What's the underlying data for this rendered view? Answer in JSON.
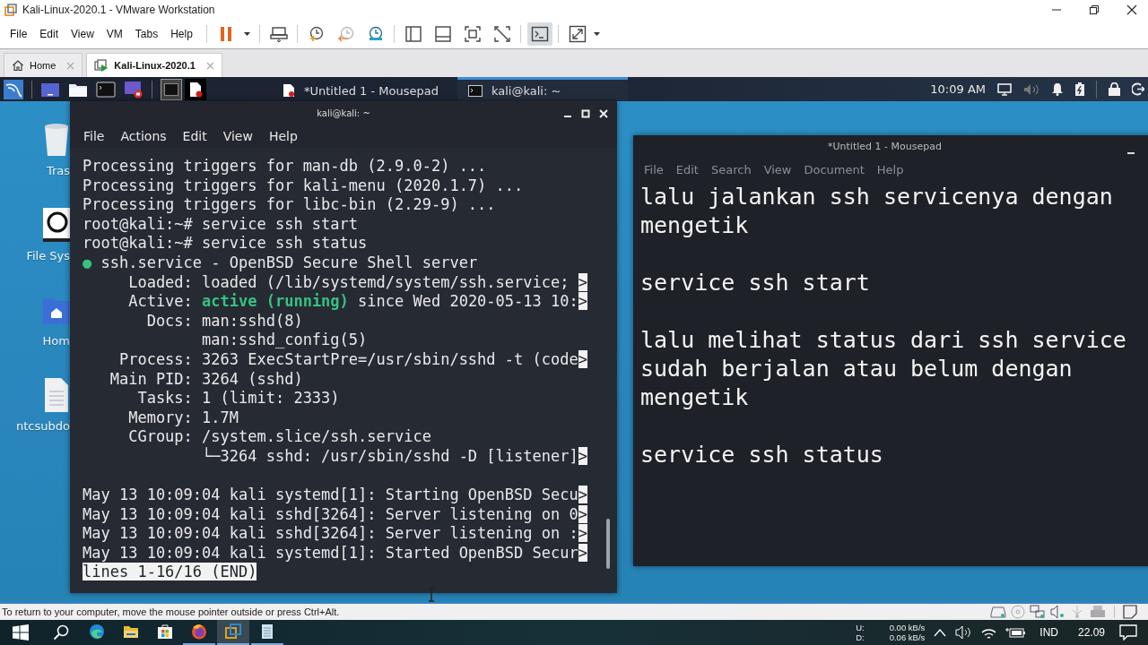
{
  "window": {
    "title": "Kali-Linux-2020.1 - VMware Workstation"
  },
  "menu": [
    "File",
    "Edit",
    "View",
    "VM",
    "Tabs",
    "Help"
  ],
  "toolbar": [
    {
      "kind": "pause",
      "selected": false
    },
    {
      "kind": "send-keys",
      "selected": false
    },
    {
      "kind": "snapshot",
      "selected": false
    },
    {
      "kind": "revert",
      "selected": false
    },
    {
      "kind": "manager",
      "selected": false
    },
    {
      "kind": "sidebar",
      "selected": false
    },
    {
      "kind": "thumbnails",
      "selected": false
    },
    {
      "kind": "fullscreen",
      "selected": false
    },
    {
      "kind": "unity",
      "selected": false
    },
    {
      "kind": "console",
      "selected": true
    },
    {
      "kind": "stretch",
      "selected": false
    }
  ],
  "tabs": [
    {
      "label": "Home",
      "kind": "home",
      "selected": false
    },
    {
      "label": "Kali-Linux-2020.1",
      "kind": "vm",
      "selected": true
    }
  ],
  "kali_panel": {
    "workspaces": [
      {
        "selected": true
      },
      {
        "selected": false
      }
    ],
    "tasks": [
      {
        "label": "*Untitled 1 - Mousepad",
        "kind": "mousepad",
        "selected": false
      },
      {
        "label": "kali@kali: ~",
        "kind": "terminal",
        "selected": true
      }
    ],
    "clock": "10:09 AM"
  },
  "desktop_icons": [
    {
      "label": "Tras",
      "kind": "trash"
    },
    {
      "label": "File Sys",
      "kind": "drive"
    },
    {
      "label": "Hom",
      "kind": "home"
    },
    {
      "label": "ntcsubdo",
      "kind": "file"
    }
  ],
  "terminal": {
    "title": "kali@kali: ~",
    "menu": [
      "File",
      "Actions",
      "Edit",
      "View",
      "Help"
    ],
    "lines": [
      {
        "kind": "text",
        "segments": [
          {
            "text": "Processing triggers for man-db (2.9.0-2) ...",
            "kind": "plain"
          }
        ]
      },
      {
        "kind": "text",
        "segments": [
          {
            "text": "Processing triggers for kali-menu (2020.1.7) ...",
            "kind": "plain"
          }
        ]
      },
      {
        "kind": "text",
        "segments": [
          {
            "text": "Processing triggers for libc-bin (2.29-9) ...",
            "kind": "plain"
          }
        ]
      },
      {
        "kind": "text",
        "segments": [
          {
            "text": "root@kali:~# service ssh start",
            "kind": "plain"
          }
        ]
      },
      {
        "kind": "text",
        "segments": [
          {
            "text": "root@kali:~# service ssh status",
            "kind": "plain"
          }
        ]
      },
      {
        "kind": "text",
        "segments": [
          {
            "text": "●",
            "kind": "green"
          },
          {
            "text": " ssh.service - OpenBSD Secure Shell server",
            "kind": "plain"
          }
        ]
      },
      {
        "kind": "text",
        "segments": [
          {
            "text": "     Loaded: loaded (/lib/systemd/system/ssh.service; ",
            "kind": "plain"
          },
          {
            "text": ">",
            "kind": "inverted"
          }
        ]
      },
      {
        "kind": "text",
        "segments": [
          {
            "text": "     Active: ",
            "kind": "plain"
          },
          {
            "text": "active (running)",
            "kind": "green"
          },
          {
            "text": " since Wed 2020-05-13 10:",
            "kind": "plain"
          },
          {
            "text": ">",
            "kind": "inverted"
          }
        ]
      },
      {
        "kind": "text",
        "segments": [
          {
            "text": "       Docs: man:sshd(8)",
            "kind": "plain"
          }
        ]
      },
      {
        "kind": "text",
        "segments": [
          {
            "text": "             man:sshd_config(5)",
            "kind": "plain"
          }
        ]
      },
      {
        "kind": "text",
        "segments": [
          {
            "text": "    Process: 3263 ExecStartPre=/usr/sbin/sshd -t (code",
            "kind": "plain"
          },
          {
            "text": ">",
            "kind": "inverted"
          }
        ]
      },
      {
        "kind": "text",
        "segments": [
          {
            "text": "   Main PID: 3264 (sshd)",
            "kind": "plain"
          }
        ]
      },
      {
        "kind": "text",
        "segments": [
          {
            "text": "      Tasks: 1 (limit: 2333)",
            "kind": "plain"
          }
        ]
      },
      {
        "kind": "text",
        "segments": [
          {
            "text": "     Memory: 1.7M",
            "kind": "plain"
          }
        ]
      },
      {
        "kind": "text",
        "segments": [
          {
            "text": "     CGroup: /system.slice/ssh.service",
            "kind": "plain"
          }
        ]
      },
      {
        "kind": "text",
        "segments": [
          {
            "text": "             └─3264 sshd: /usr/sbin/sshd -D [listener]",
            "kind": "plain"
          },
          {
            "text": ">",
            "kind": "inverted"
          }
        ]
      },
      {
        "kind": "blank"
      },
      {
        "kind": "text",
        "segments": [
          {
            "text": "May 13 10:09:04 kali systemd[1]: Starting OpenBSD Secu",
            "kind": "plain"
          },
          {
            "text": ">",
            "kind": "inverted"
          }
        ]
      },
      {
        "kind": "text",
        "segments": [
          {
            "text": "May 13 10:09:04 kali sshd[3264]: Server listening on 0",
            "kind": "plain"
          },
          {
            "text": ">",
            "kind": "inverted"
          }
        ]
      },
      {
        "kind": "text",
        "segments": [
          {
            "text": "May 13 10:09:04 kali sshd[3264]: Server listening on :",
            "kind": "plain"
          },
          {
            "text": ">",
            "kind": "inverted"
          }
        ]
      },
      {
        "kind": "text",
        "segments": [
          {
            "text": "May 13 10:09:04 kali systemd[1]: Started OpenBSD Secur",
            "kind": "plain"
          },
          {
            "text": ">",
            "kind": "inverted"
          }
        ]
      },
      {
        "kind": "text",
        "segments": [
          {
            "text": "lines 1-16/16 (END)",
            "kind": "inverted"
          }
        ]
      }
    ]
  },
  "mousepad": {
    "title": "*Untitled 1 - Mousepad",
    "menu": [
      "File",
      "Edit",
      "Search",
      "View",
      "Document",
      "Help"
    ],
    "paragraphs": [
      [
        "lalu jalankan ssh servicenya dengan",
        "mengetik"
      ],
      [
        "service ssh start"
      ],
      [
        "lalu melihat status dari ssh service",
        "sudah berjalan atau belum dengan",
        "mengetik"
      ],
      [
        "service ssh status"
      ]
    ]
  },
  "status_bar": {
    "message": "To return to your computer, move the mouse pointer outside or press Ctrl+Alt."
  },
  "taskbar": {
    "apps": [
      {
        "kind": "edge",
        "running": false,
        "selected": false
      },
      {
        "kind": "explorer",
        "running": false,
        "selected": false
      },
      {
        "kind": "store",
        "running": false,
        "selected": false
      },
      {
        "kind": "firefox",
        "running": true,
        "selected": false
      },
      {
        "kind": "vmware",
        "running": true,
        "selected": true
      },
      {
        "kind": "notepad",
        "running": true,
        "selected": false
      }
    ],
    "upload_label": "U:",
    "download_label": "D:",
    "upload_rate": "0.00 kB/s",
    "download_rate": "0.06 kB/s",
    "language": "IND",
    "time": "22.09"
  }
}
